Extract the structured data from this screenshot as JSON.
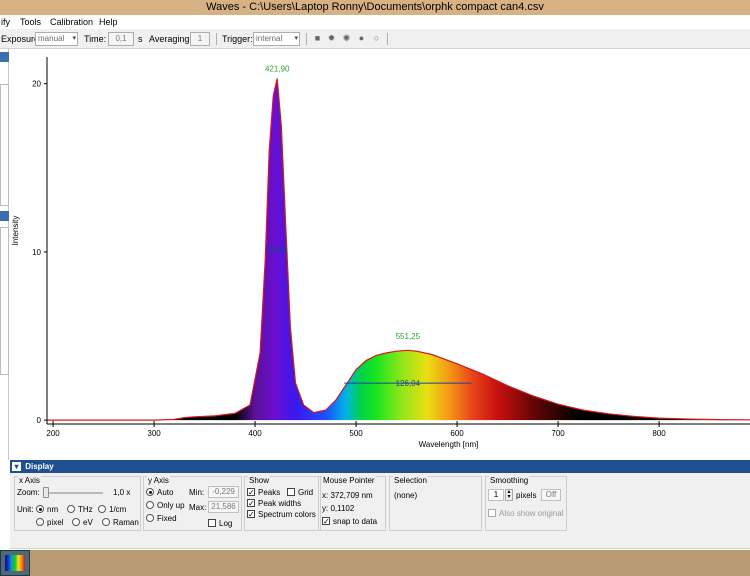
{
  "window": {
    "title": "Waves  -  C:\\Users\\Laptop Ronny\\Documents\\orphk compact can4.csv"
  },
  "menu": [
    "ify",
    "Tools",
    "Calibration",
    "Help"
  ],
  "toolbar": {
    "exposure_label": "Exposure:",
    "exposure_value": "manual",
    "time_label": "Time:",
    "time_value": "0,1",
    "time_unit": "s",
    "averaging_label": "Averaging:",
    "averaging_value": "1",
    "trigger_label": "Trigger:",
    "trigger_value": "internal"
  },
  "display": {
    "header": "Display",
    "xaxis": {
      "title": "x Axis",
      "zoom_label": "Zoom:",
      "zoom_value": "1,0 x",
      "unit_label": "Unit:",
      "opt_nm": "nm",
      "opt_thz": "THz",
      "opt_cm": "1/cm",
      "opt_pixel": "pixel",
      "opt_ev": "eV",
      "opt_raman": "Raman",
      "selected": "nm"
    },
    "yaxis": {
      "title": "y Axis",
      "opt_auto": "Auto",
      "opt_onlyup": "Only up",
      "opt_fixed": "Fixed",
      "min_label": "Min:",
      "min_value": "-0,229",
      "max_label": "Max:",
      "max_value": "21,586",
      "log_label": "Log",
      "selected": "Auto"
    },
    "show": {
      "title": "Show",
      "peaks": "Peaks",
      "grid": "Grid",
      "peak_widths": "Peak widths",
      "spectrum_colors": "Spectrum colors"
    },
    "mouse": {
      "title": "Mouse Pointer",
      "x": "x: 372,709 nm",
      "y": "y: 0,1102",
      "snap": "snap to data"
    },
    "selection": {
      "title": "Selection",
      "value": "(none)"
    },
    "smoothing": {
      "title": "Smoothing",
      "value": "1",
      "unit": "pixels",
      "off_btn": "Off",
      "also_show": "Also show original"
    }
  },
  "chart_data": {
    "type": "line",
    "xlabel": "Wavelength [nm]",
    "ylabel": "Intensity",
    "xlim": [
      194,
      890
    ],
    "ylim": [
      -0.229,
      21.586
    ],
    "xticks": [
      200,
      300,
      400,
      500,
      600,
      700,
      800
    ],
    "yticks": [
      0,
      10,
      20
    ],
    "peaks": [
      {
        "x": 421.9,
        "y": 20.3,
        "label": "421,90",
        "width_label": "19,52",
        "width": 19.52
      },
      {
        "x": 551.25,
        "y": 4.4,
        "label": "551,25",
        "width_label": "126,04",
        "width": 126.04
      }
    ],
    "series": [
      {
        "x": [
          194,
          300,
          320,
          330,
          340,
          360,
          380,
          395,
          405,
          410,
          414,
          418,
          421.9,
          426,
          430,
          435,
          440,
          448,
          458,
          470,
          480,
          490,
          500,
          510,
          520,
          530,
          540,
          551.25,
          560,
          575,
          600,
          625,
          650,
          675,
          700,
          725,
          750,
          775,
          800,
          830,
          860,
          890
        ],
        "y": [
          0.0,
          0.0,
          0.05,
          0.15,
          0.2,
          0.25,
          0.4,
          0.9,
          4.0,
          9.5,
          16.0,
          19.3,
          20.3,
          17.5,
          12.0,
          5.5,
          2.2,
          0.9,
          0.45,
          0.6,
          1.2,
          2.1,
          3.0,
          3.55,
          3.85,
          4.0,
          4.1,
          4.15,
          4.1,
          3.9,
          3.35,
          2.75,
          2.05,
          1.45,
          0.95,
          0.6,
          0.38,
          0.22,
          0.12,
          0.06,
          0.03,
          0.02
        ]
      }
    ]
  },
  "colors": {
    "curve": "#d41a1a",
    "peak_label": "#2f9e2f",
    "width_line": "#1c3f9e",
    "display_header": "#1e4f91"
  }
}
